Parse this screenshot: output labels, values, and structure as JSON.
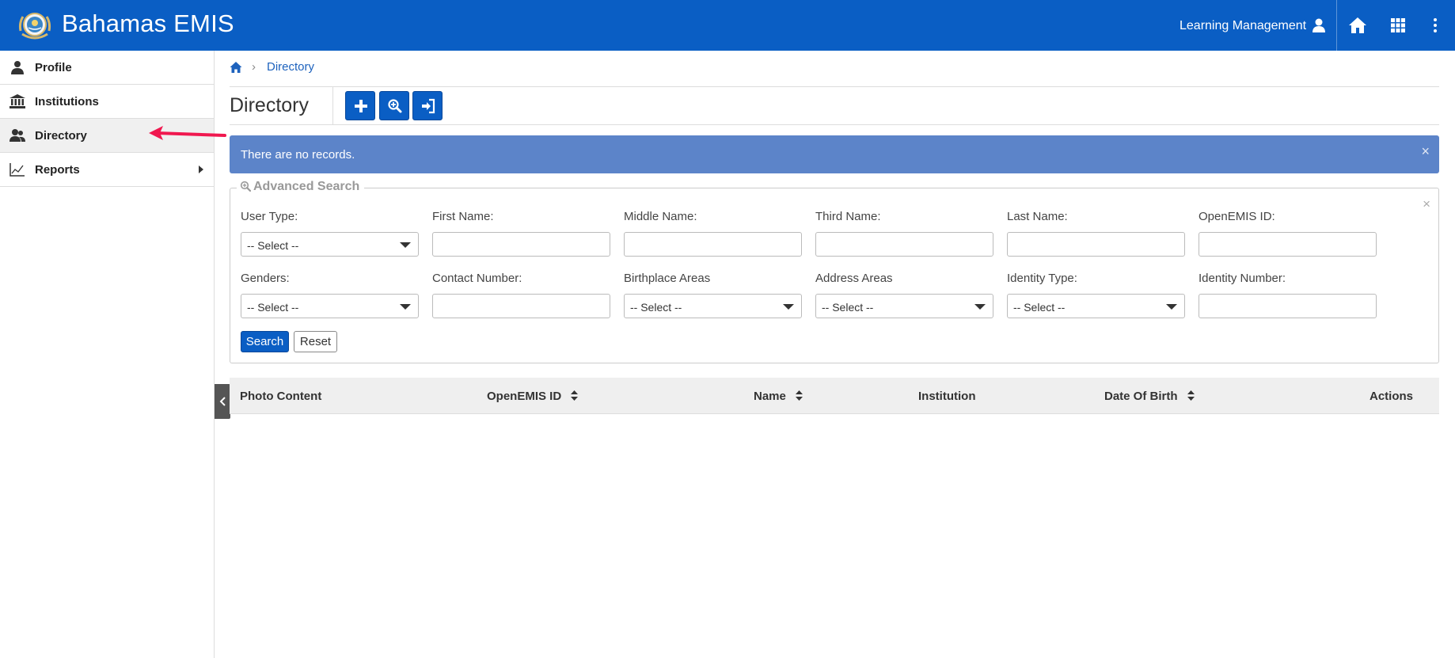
{
  "header": {
    "app_title": "Bahamas EMIS",
    "user_menu_label": "Learning Management",
    "brand_color": "#0a5ec4"
  },
  "sidebar": {
    "items": [
      {
        "label": "Profile",
        "icon": "user-icon"
      },
      {
        "label": "Institutions",
        "icon": "bank-icon"
      },
      {
        "label": "Directory",
        "icon": "users-icon",
        "active": true
      },
      {
        "label": "Reports",
        "icon": "line-chart-icon",
        "has_submenu": true
      }
    ],
    "annotation_arrow_color": "#f0184f"
  },
  "breadcrumb": {
    "current": "Directory"
  },
  "page": {
    "title": "Directory",
    "toolbar": [
      {
        "icon": "plus-icon"
      },
      {
        "icon": "search-plus-icon"
      },
      {
        "icon": "sign-in-icon"
      }
    ]
  },
  "alert": {
    "message": "There are no records.",
    "close": "×",
    "color": "#5c84c9"
  },
  "advanced_search": {
    "legend": "Advanced Search",
    "close": "×",
    "fields": {
      "user_type": {
        "label": "User Type:",
        "value": "-- Select --"
      },
      "first_name": {
        "label": "First Name:",
        "value": ""
      },
      "middle_name": {
        "label": "Middle Name:",
        "value": ""
      },
      "third_name": {
        "label": "Third Name:",
        "value": ""
      },
      "last_name": {
        "label": "Last Name:",
        "value": ""
      },
      "openemis_id": {
        "label": "OpenEMIS ID:",
        "value": ""
      },
      "genders": {
        "label": "Genders:",
        "value": "-- Select --"
      },
      "contact_number": {
        "label": "Contact Number:",
        "value": ""
      },
      "birthplace_areas": {
        "label": "Birthplace Areas",
        "value": "-- Select --"
      },
      "address_areas": {
        "label": "Address Areas",
        "value": "-- Select --"
      },
      "identity_type": {
        "label": "Identity Type:",
        "value": "-- Select --"
      },
      "identity_number": {
        "label": "Identity Number:",
        "value": ""
      }
    },
    "search_label": "Search",
    "reset_label": "Reset"
  },
  "table": {
    "columns": [
      "Photo Content",
      "OpenEMIS ID",
      "Name",
      "Institution",
      "Date Of Birth",
      "Actions"
    ],
    "rows": []
  }
}
